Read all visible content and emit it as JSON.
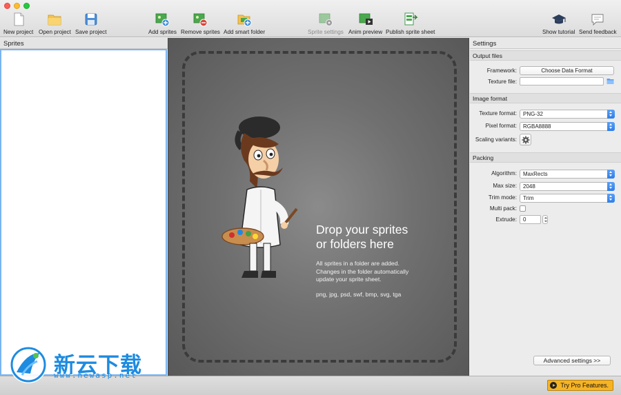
{
  "toolbar": {
    "new_project": "New project",
    "open_project": "Open project",
    "save_project": "Save project",
    "add_sprites": "Add sprites",
    "remove_sprites": "Remove sprites",
    "add_smart_folder": "Add smart folder",
    "sprite_settings": "Sprite settings",
    "anim_preview": "Anim preview",
    "publish_sprite_sheet": "Publish sprite sheet",
    "show_tutorial": "Show tutorial",
    "send_feedback": "Send feedback"
  },
  "sprites_panel": {
    "title": "Sprites"
  },
  "canvas": {
    "drop_title_line1": "Drop your sprites",
    "drop_title_line2": "or folders here",
    "desc_line1": "All sprites in a folder are added.",
    "desc_line2": "Changes in the folder automatically",
    "desc_line3": "update your sprite sheet.",
    "formats": "png, jpg, psd, swf, bmp, svg, tga"
  },
  "settings": {
    "title": "Settings",
    "output_files": {
      "header": "Output files",
      "framework_label": "Framework:",
      "framework_button": "Choose Data Format",
      "texture_file_label": "Texture file:",
      "texture_file_value": ""
    },
    "image_format": {
      "header": "Image format",
      "texture_format_label": "Texture format:",
      "texture_format_value": "PNG-32",
      "pixel_format_label": "Pixel format:",
      "pixel_format_value": "RGBA8888",
      "scaling_variants_label": "Scaling variants:"
    },
    "packing": {
      "header": "Packing",
      "algorithm_label": "Algorithm:",
      "algorithm_value": "MaxRects",
      "max_size_label": "Max size:",
      "max_size_value": "2048",
      "trim_mode_label": "Trim mode:",
      "trim_mode_value": "Trim",
      "multi_pack_label": "Multi pack:",
      "multi_pack_checked": false,
      "extrude_label": "Extrude:",
      "extrude_value": "0"
    },
    "advanced_button": "Advanced settings >>"
  },
  "bottom_bar": {
    "pro_button": "Try Pro Features."
  },
  "watermark": {
    "brand_cn": "新云下载",
    "url": "www.newasp.net"
  },
  "colors": {
    "accent": "#2f7de8",
    "pro": "#f6b324",
    "canvas": "#6e6e6e"
  }
}
